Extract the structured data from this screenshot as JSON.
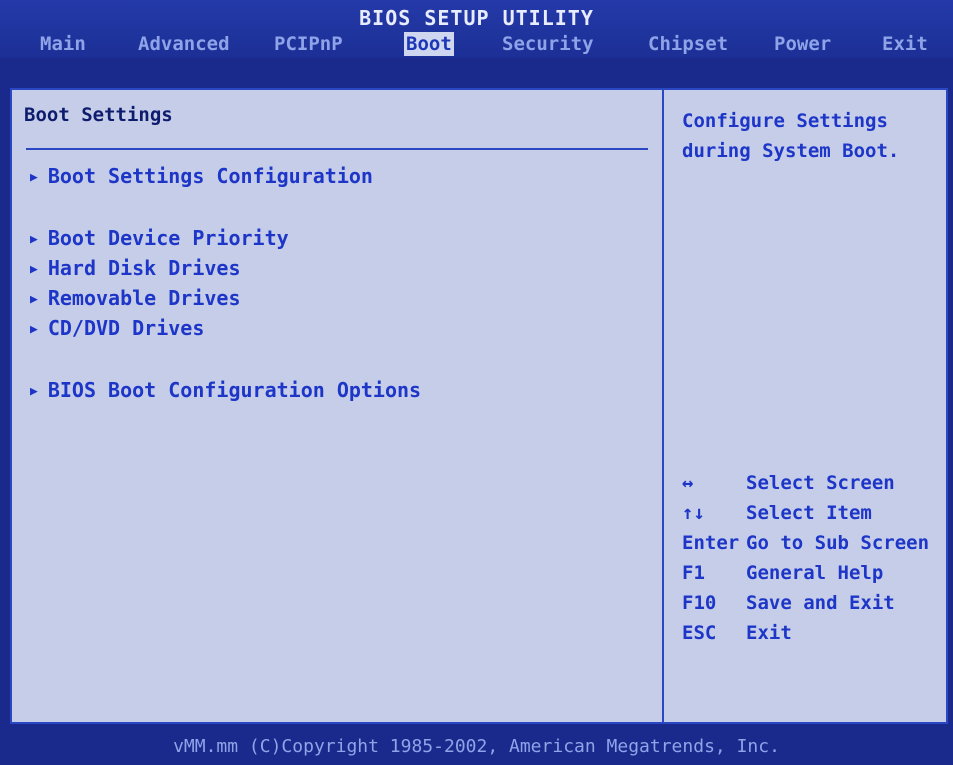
{
  "header": {
    "title": "BIOS SETUP UTILITY",
    "tabs": [
      "Main",
      "Advanced",
      "PCIPnP",
      "Boot",
      "Security",
      "Chipset",
      "Power",
      "Exit"
    ],
    "active_tab": "Boot"
  },
  "main": {
    "section_title": "Boot Settings",
    "items": [
      "Boot Settings Configuration",
      "Boot Device Priority",
      "Hard Disk Drives",
      "Removable Drives",
      "CD/DVD Drives",
      "BIOS Boot Configuration Options"
    ]
  },
  "help": {
    "text": "Configure Settings during System Boot.",
    "keys": [
      {
        "key": "↔",
        "action": "Select Screen"
      },
      {
        "key": "↑↓",
        "action": "Select Item"
      },
      {
        "key": "Enter",
        "action": "Go to Sub Screen"
      },
      {
        "key": "F1",
        "action": "General Help"
      },
      {
        "key": "F10",
        "action": "Save and Exit"
      },
      {
        "key": "ESC",
        "action": "Exit"
      }
    ]
  },
  "footer": {
    "text": "vMM.mm (C)Copyright 1985-2002, American Megatrends, Inc."
  },
  "icons": {
    "submenu_arrow": "triangle-right-icon"
  },
  "colors": {
    "background": "#1a2a8c",
    "panel": "#c6cde8",
    "accent": "#1d36c8"
  }
}
